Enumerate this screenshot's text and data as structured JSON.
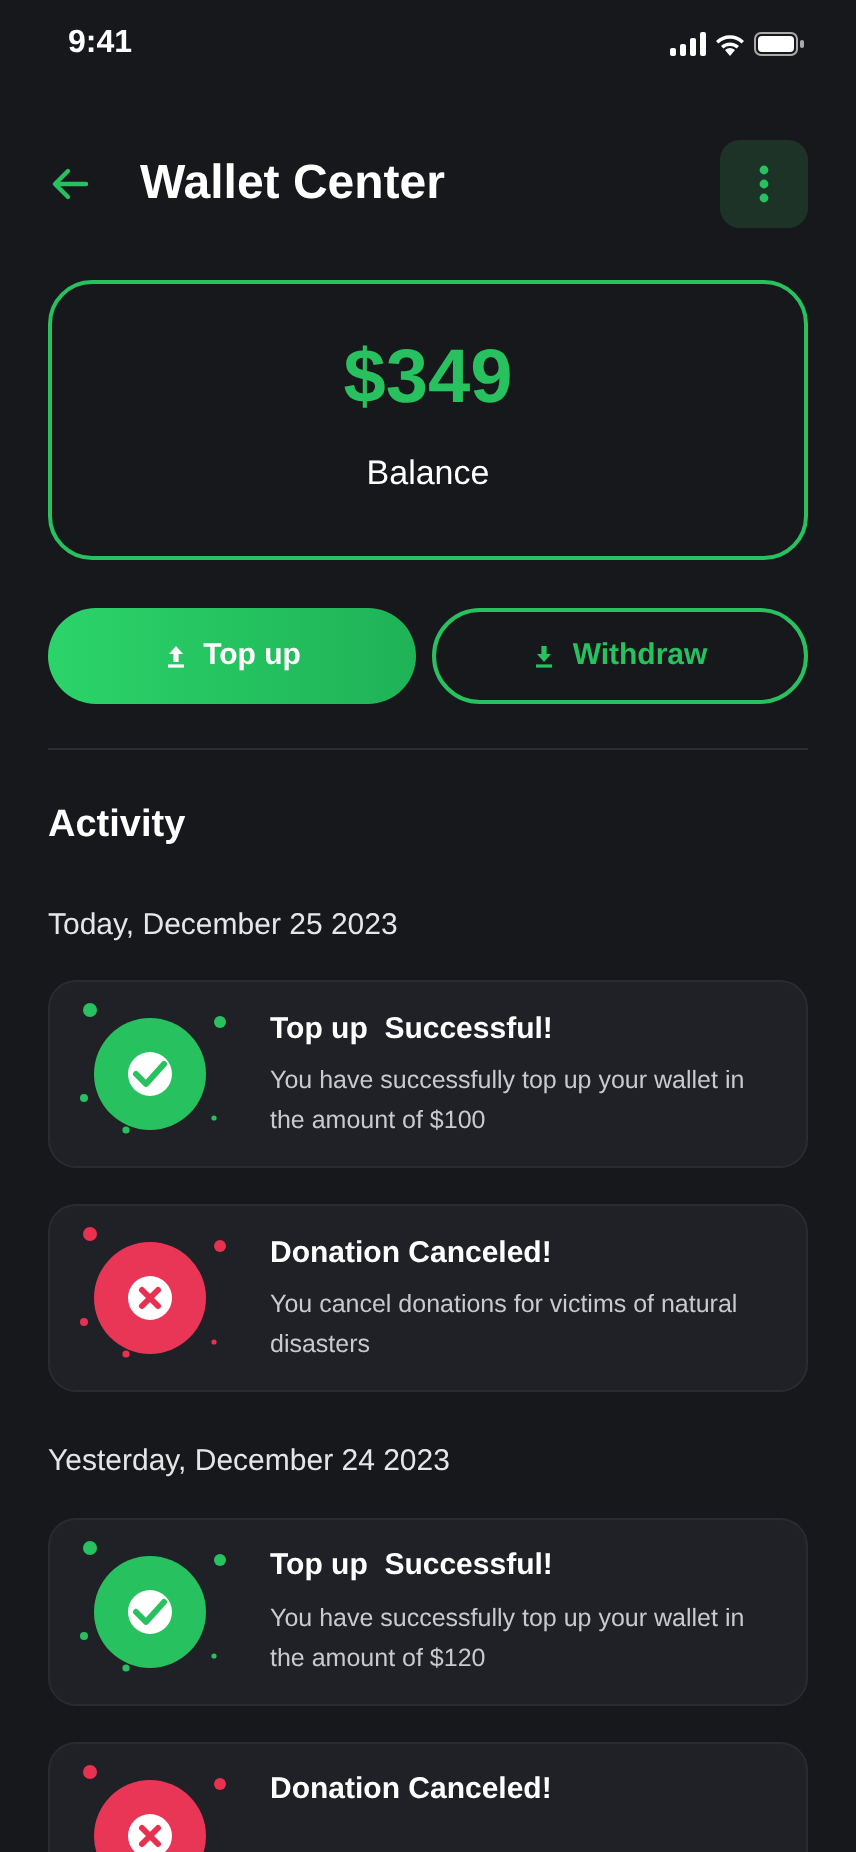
{
  "status_bar": {
    "time": "9:41"
  },
  "header": {
    "title": "Wallet Center"
  },
  "balance": {
    "amount": "$349",
    "label": "Balance"
  },
  "actions": [
    {
      "label": "Top up",
      "kind": "primary"
    },
    {
      "label": "Withdraw",
      "kind": "outline"
    }
  ],
  "activity": {
    "title": "Activity",
    "groups": [
      {
        "date": "Today, December 25 2023",
        "items": [
          {
            "kind": "success",
            "title": "Top up  Successful!",
            "text": "You have successfully top up your wallet in the amount of $100"
          },
          {
            "kind": "canceled",
            "title": "Donation Canceled!",
            "text": "You cancel donations for victims of natural disasters"
          }
        ]
      },
      {
        "date": "Yesterday, December 24 2023",
        "items": [
          {
            "kind": "success",
            "title": "Top up  Successful!",
            "text": "You have successfully top up your wallet in the amount of $120"
          },
          {
            "kind": "canceled",
            "title": "Donation Canceled!"
          }
        ]
      }
    ]
  }
}
